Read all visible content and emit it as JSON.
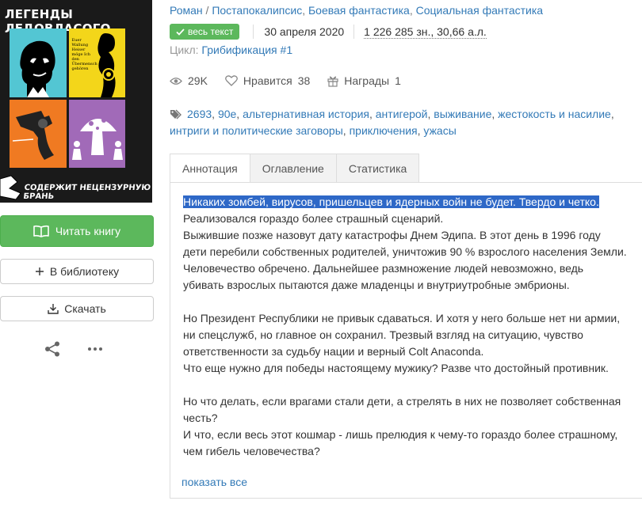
{
  "cover": {
    "title": "ЛЕГЕНДЫ ЛЕДОВЛАСОГО",
    "warning": "СОДЕРЖИТ НЕЦЕНЗУРНУЮ БРАНЬ",
    "panel_colors": [
      "#53c6d3",
      "#f3d61a",
      "#f07a22",
      "#a16ab8"
    ]
  },
  "book": {
    "genres_prefix": "Роман",
    "genres": [
      "Постапокалипсис",
      "Боевая фантастика",
      "Социальная фантастика"
    ],
    "full_text_badge": "весь текст",
    "date": "30 апреля 2020",
    "size": "1 226 285 зн., 30,66 а.л.",
    "cycle_label": "Цикл:",
    "cycle_value": "Грибификация #1"
  },
  "counters": {
    "views": "29K",
    "likes_label": "Нравится",
    "likes_count": "38",
    "awards_label": "Награды",
    "awards_count": "1"
  },
  "tags": [
    "2693",
    "90е",
    "альтернативная история",
    "антигерой",
    "выживание",
    "жестокость и насилие",
    "интриги и политические заговоры",
    "приключения",
    "ужасы"
  ],
  "actions": {
    "read": "Читать книгу",
    "library": "В библиотеку",
    "download": "Скачать"
  },
  "tabs": {
    "annotation": "Аннотация",
    "toc": "Оглавление",
    "stats": "Статистика"
  },
  "annotation": {
    "highlighted": "Никаких зомбей, вирусов, пришельцев и ядерных войн не будет. Твердо и четко.",
    "lines": [
      "Реализовался гораздо более страшный сценарий.",
      "Выжившие позже назовут дату катастрофы Днем Эдипа. В этот день в 1996 году дети перебили собственных родителей, уничтожив 90 % взрослого населения Земли. Человечество обречено. Дальнейшее размножение людей невозможно, ведь убивать взрослых пытаются даже младенцы и внутриутробные эмбрионы.",
      "",
      "Но Президент Республики не привык сдаваться. И хотя у него больше нет ни армии, ни спецслужб, но главное он сохранил. Трезвый взгляд на ситуацию, чувство ответственности за судьбу нации и верный Colt Anaconda.",
      "Что еще нужно для победы настоящему мужику? Разве что достойный противник.",
      "",
      "Но что делать, если врагами стали дети, а стрелять в них не позволяет собственная честь?",
      "И что, если весь этот кошмар - лишь прелюдия к чему-то гораздо более страшному, чем гибель человечества?"
    ],
    "show_all": "показать все"
  },
  "colors": {
    "accent": "#337ab7",
    "success": "#5cb85c",
    "selection": "#2e68c7"
  }
}
